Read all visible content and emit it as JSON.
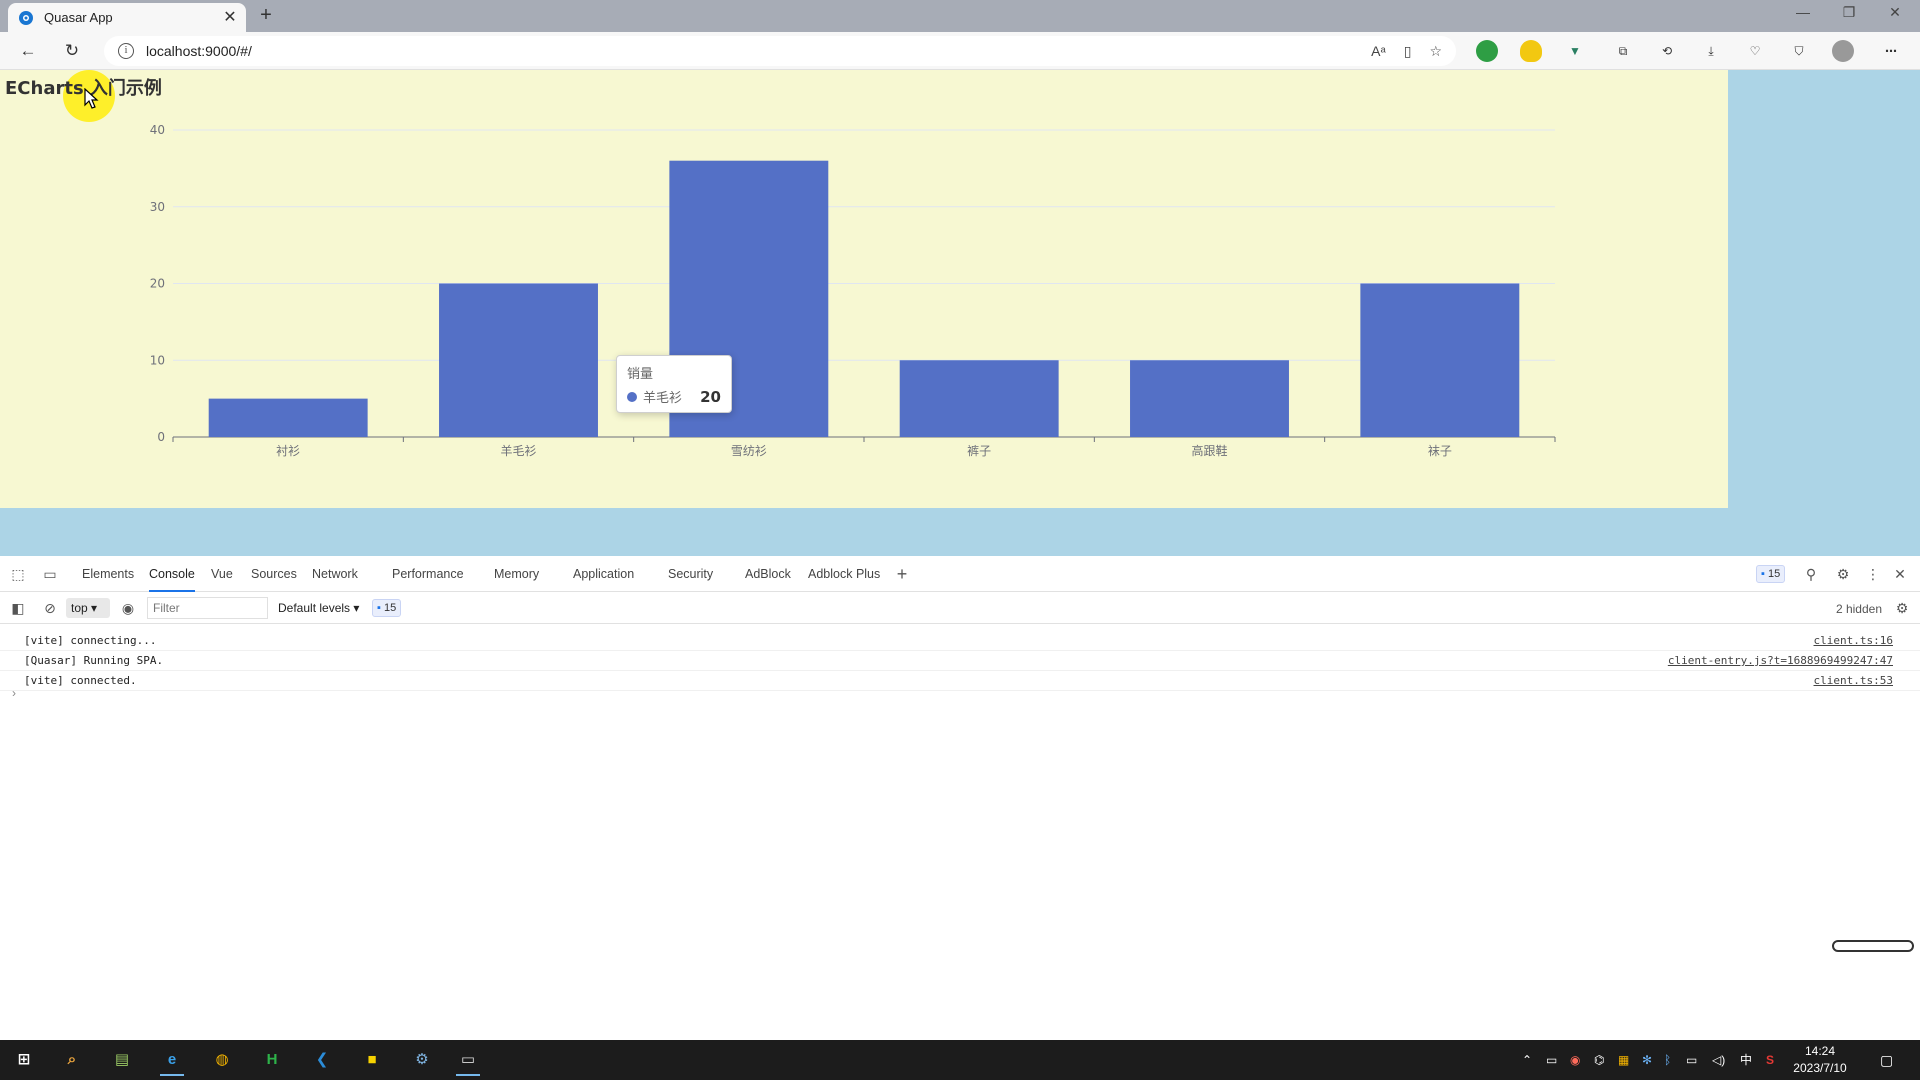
{
  "browser": {
    "tab_title": "Quasar App",
    "url": "localhost:9000/#/"
  },
  "page": {
    "heading": "ECharts 入门示例"
  },
  "chart_data": {
    "type": "bar",
    "categories": [
      "衬衫",
      "羊毛衫",
      "雪纺衫",
      "裤子",
      "高跟鞋",
      "袜子"
    ],
    "series": [
      {
        "name": "销量",
        "values": [
          5,
          20,
          36,
          10,
          10,
          20
        ]
      }
    ],
    "yticks": [
      "0",
      "10",
      "20",
      "30",
      "40"
    ],
    "ylim": [
      0,
      40
    ],
    "color": "#5470c6",
    "grid": true
  },
  "tooltip": {
    "title": "销量",
    "label": "羊毛衫",
    "value": "20"
  },
  "devtools": {
    "tabs": [
      "Elements",
      "Console",
      "Vue",
      "Sources",
      "Network",
      "Performance",
      "Memory",
      "Application",
      "Security",
      "AdBlock",
      "Adblock Plus"
    ],
    "active_tab": "Console",
    "issues_count": "15",
    "context": "top",
    "filter_placeholder": "Filter",
    "levels": "Default levels",
    "hidden_text": "2 hidden",
    "messages": [
      {
        "text": "[vite] connecting...",
        "source": "client.ts:16"
      },
      {
        "text": "[Quasar] Running SPA.",
        "source": "client-entry.js?t=1688969499247:47"
      },
      {
        "text": "[vite] connected.",
        "source": "client.ts:53"
      }
    ]
  },
  "taskbar": {
    "time": "14:24",
    "date": "2023/7/10",
    "ime": "中"
  }
}
